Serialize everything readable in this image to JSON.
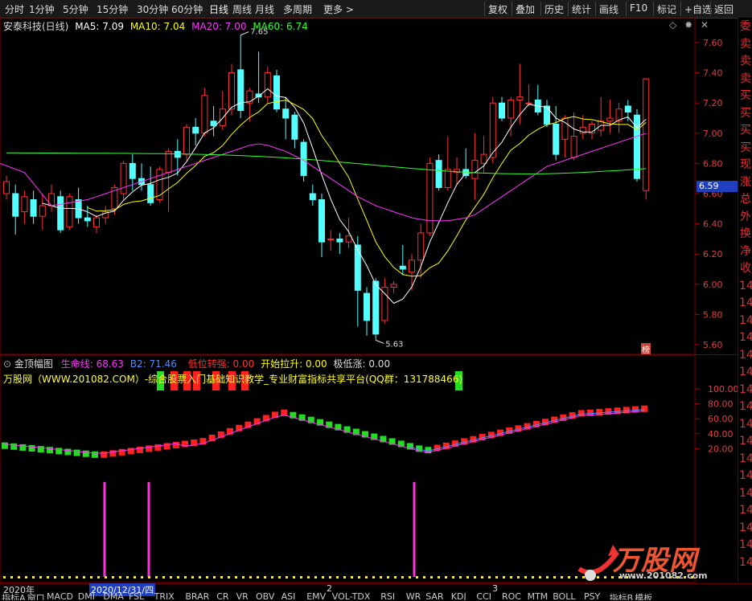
{
  "toolbar": {
    "periods": [
      "分时",
      "1分钟",
      "5分钟",
      "15分钟",
      "30分钟",
      "60分钟",
      "日线",
      "周线",
      "月线",
      "多周期",
      "更多 >"
    ],
    "active_period": "日线",
    "actions": [
      "复权",
      "叠加",
      "历史",
      "统计",
      "画线",
      "F10",
      "标记",
      "+自选",
      "返回"
    ]
  },
  "main_legend": {
    "title": "安泰科技(日线)",
    "ma5": "MA5: 7.09",
    "ma10": "MA10: 7.04",
    "ma20": "MA20: 7.00",
    "ma60": "MA60: 6.74"
  },
  "price_axis": [
    "7.60",
    "7.40",
    "7.20",
    "7.00",
    "6.80",
    "6.60",
    "6.40",
    "6.20",
    "6.00",
    "5.80",
    "5.60"
  ],
  "high_mark": "7.65",
  "low_mark": "5.63",
  "current_price": "6.59",
  "rank_badge": "榜",
  "sub_legend": {
    "title": "金顶幅图",
    "life_line": "生命线: 68.63",
    "b2": "B2: 71.46",
    "low_strong": "低位转强: 0.00",
    "start_rise": "开始拉升: 0.00",
    "extreme_low": "极低涨: 0.00"
  },
  "sub_banner": "万股网（WWW.201082.COM）-综合股票入门基础知识教学_专业财富指标共享平台(QQ群：131788466)",
  "sub_axis": [
    "100.00",
    "80.00",
    "60.00",
    "40.00",
    "20.00"
  ],
  "right_strip": [
    "委",
    "卖",
    "卖",
    "卖",
    "买",
    "买",
    "买",
    "买",
    "现",
    "涨",
    "总",
    "外",
    "换",
    "净",
    "收",
    "14",
    "14",
    "14",
    "14",
    "14",
    "14",
    "14",
    "14",
    "14",
    "14",
    "14",
    "14",
    "14",
    "14",
    "14",
    "14",
    "14"
  ],
  "bottom_labels": {
    "year": "2020年",
    "date_cursor": "2020/12/31/四",
    "m2": "2",
    "m3": "3"
  },
  "indicator_tabs": [
    "指标A",
    "窗口",
    "MACD",
    "DMI",
    "DMA",
    "FSL",
    "TRIX",
    "BRAR",
    "CR",
    "VR",
    "OBV",
    "ASI",
    "EMV",
    "VOL-TDX",
    "RSI",
    "WR",
    "SAR",
    "KDJ",
    "CCI",
    "ROC",
    "MTM",
    "BOLL",
    "PSY",
    "指标B",
    "模板"
  ],
  "watermark": {
    "brand": "万股网",
    "url": "www.201082.com"
  },
  "colors": {
    "up": "#ff3030",
    "down": "#54ffff",
    "ma5": "#ffffff",
    "ma10": "#ffff00",
    "ma20": "#ff33ff",
    "ma60": "#33ff33"
  }
}
